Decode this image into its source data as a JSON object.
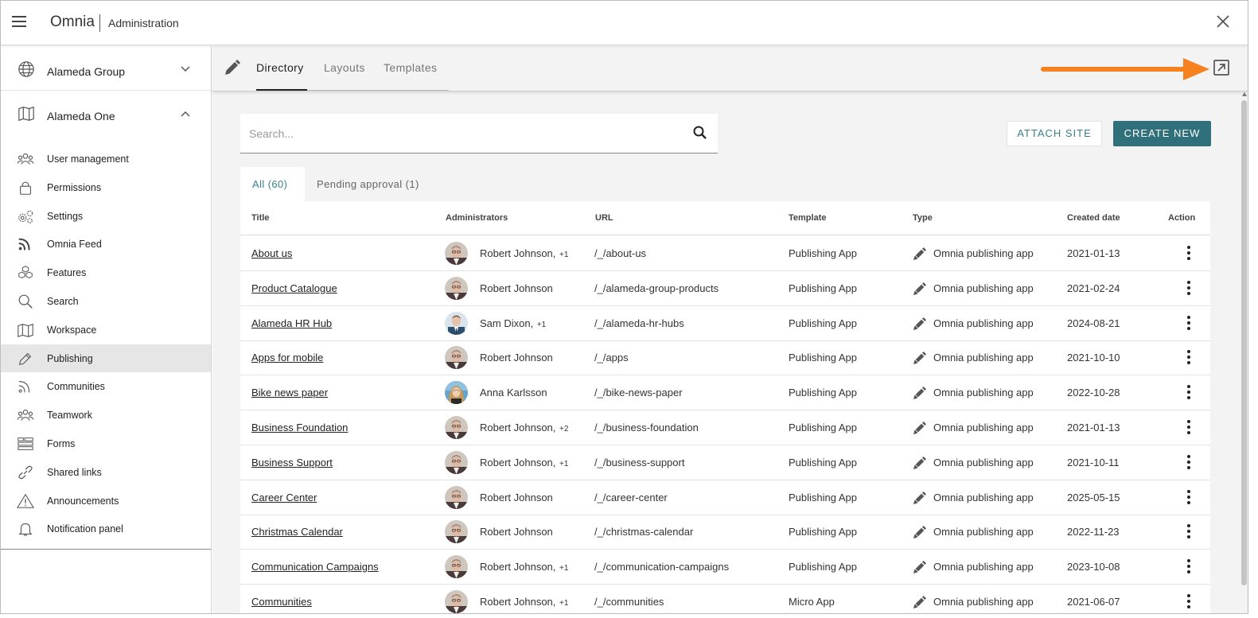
{
  "header": {
    "app_name": "Omnia",
    "section": "Administration",
    "menu_icon": "hamburger-menu-icon",
    "close_icon": "close-icon"
  },
  "sidebar": {
    "groups": [
      {
        "label": "Alameda Group",
        "icon": "globe-icon",
        "expanded": false
      },
      {
        "label": "Alameda One",
        "icon": "map-icon",
        "expanded": true
      }
    ],
    "items": [
      {
        "label": "User management",
        "icon": "users-icon"
      },
      {
        "label": "Permissions",
        "icon": "lock-icon"
      },
      {
        "label": "Settings",
        "icon": "gears-icon"
      },
      {
        "label": "Omnia Feed",
        "icon": "rss-icon"
      },
      {
        "label": "Features",
        "icon": "cubes-icon"
      },
      {
        "label": "Search",
        "icon": "search-icon"
      },
      {
        "label": "Workspace",
        "icon": "map-icon"
      },
      {
        "label": "Publishing",
        "icon": "pencil-icon",
        "active": true
      },
      {
        "label": "Communities",
        "icon": "feed-icon"
      },
      {
        "label": "Teamwork",
        "icon": "team-icon"
      },
      {
        "label": "Forms",
        "icon": "forms-icon"
      },
      {
        "label": "Shared links",
        "icon": "link-icon"
      },
      {
        "label": "Announcements",
        "icon": "warning-icon"
      },
      {
        "label": "Notification panel",
        "icon": "bell-icon"
      }
    ]
  },
  "main": {
    "tabs": [
      {
        "label": "Directory",
        "active": true
      },
      {
        "label": "Layouts",
        "active": false
      },
      {
        "label": "Templates",
        "active": false
      }
    ],
    "search": {
      "placeholder": "Search..."
    },
    "buttons": {
      "attach": "ATTACH SITE",
      "create": "CREATE NEW"
    },
    "subtabs": {
      "all": "All (60)",
      "pending": "Pending approval (1)"
    },
    "table": {
      "headers": {
        "title": "Title",
        "admins": "Administrators",
        "url": "URL",
        "template": "Template",
        "type": "Type",
        "created": "Created date",
        "action": "Action"
      },
      "rows": [
        {
          "title": "About us",
          "admin": "Robert Johnson",
          "extra": "+1",
          "avatar": "robert",
          "url": "/_/about-us",
          "template": "Publishing App",
          "type": "Omnia publishing app",
          "created": "2021-01-13"
        },
        {
          "title": "Product Catalogue",
          "admin": "Robert Johnson",
          "extra": "",
          "avatar": "robert",
          "url": "/_/alameda-group-products",
          "template": "Publishing App",
          "type": "Omnia publishing app",
          "created": "2021-02-24"
        },
        {
          "title": "Alameda HR Hub",
          "admin": "Sam Dixon",
          "extra": "+1",
          "avatar": "sam",
          "url": "/_/alameda-hr-hubs",
          "template": "Publishing App",
          "type": "Omnia publishing app",
          "created": "2024-08-21"
        },
        {
          "title": "Apps for mobile",
          "admin": "Robert Johnson",
          "extra": "",
          "avatar": "robert",
          "url": "/_/apps",
          "template": "Publishing App",
          "type": "Omnia publishing app",
          "created": "2021-10-10"
        },
        {
          "title": "Bike news paper",
          "admin": "Anna Karlsson",
          "extra": "",
          "avatar": "anna",
          "url": "/_/bike-news-paper",
          "template": "Publishing App",
          "type": "Omnia publishing app",
          "created": "2022-10-28"
        },
        {
          "title": "Business Foundation",
          "admin": "Robert Johnson",
          "extra": "+2",
          "avatar": "robert",
          "url": "/_/business-foundation",
          "template": "Publishing App",
          "type": "Omnia publishing app",
          "created": "2021-01-13"
        },
        {
          "title": "Business Support",
          "admin": "Robert Johnson",
          "extra": "+1",
          "avatar": "robert",
          "url": "/_/business-support",
          "template": "Publishing App",
          "type": "Omnia publishing app",
          "created": "2021-10-11"
        },
        {
          "title": "Career Center",
          "admin": "Robert Johnson",
          "extra": "",
          "avatar": "robert",
          "url": "/_/career-center",
          "template": "Publishing App",
          "type": "Omnia publishing app",
          "created": "2025-05-15"
        },
        {
          "title": "Christmas Calendar",
          "admin": "Robert Johnson",
          "extra": "",
          "avatar": "robert",
          "url": "/_/christmas-calendar",
          "template": "Publishing App",
          "type": "Omnia publishing app",
          "created": "2022-11-23"
        },
        {
          "title": "Communication Campaigns",
          "admin": "Robert Johnson",
          "extra": "+1",
          "avatar": "robert",
          "url": "/_/communication-campaigns",
          "template": "Publishing App",
          "type": "Omnia publishing app",
          "created": "2023-10-08"
        },
        {
          "title": "Communities",
          "admin": "Robert Johnson",
          "extra": "+1",
          "avatar": "robert",
          "url": "/_/communities",
          "template": "Micro App",
          "type": "Omnia publishing app",
          "created": "2021-06-07"
        }
      ]
    }
  },
  "colors": {
    "accent": "#30707a",
    "accent_text": "#3a7f8a",
    "annotation_arrow": "#f5821f",
    "active_nav_bg": "#e6e6e6",
    "main_bg": "#f3f3f3"
  }
}
